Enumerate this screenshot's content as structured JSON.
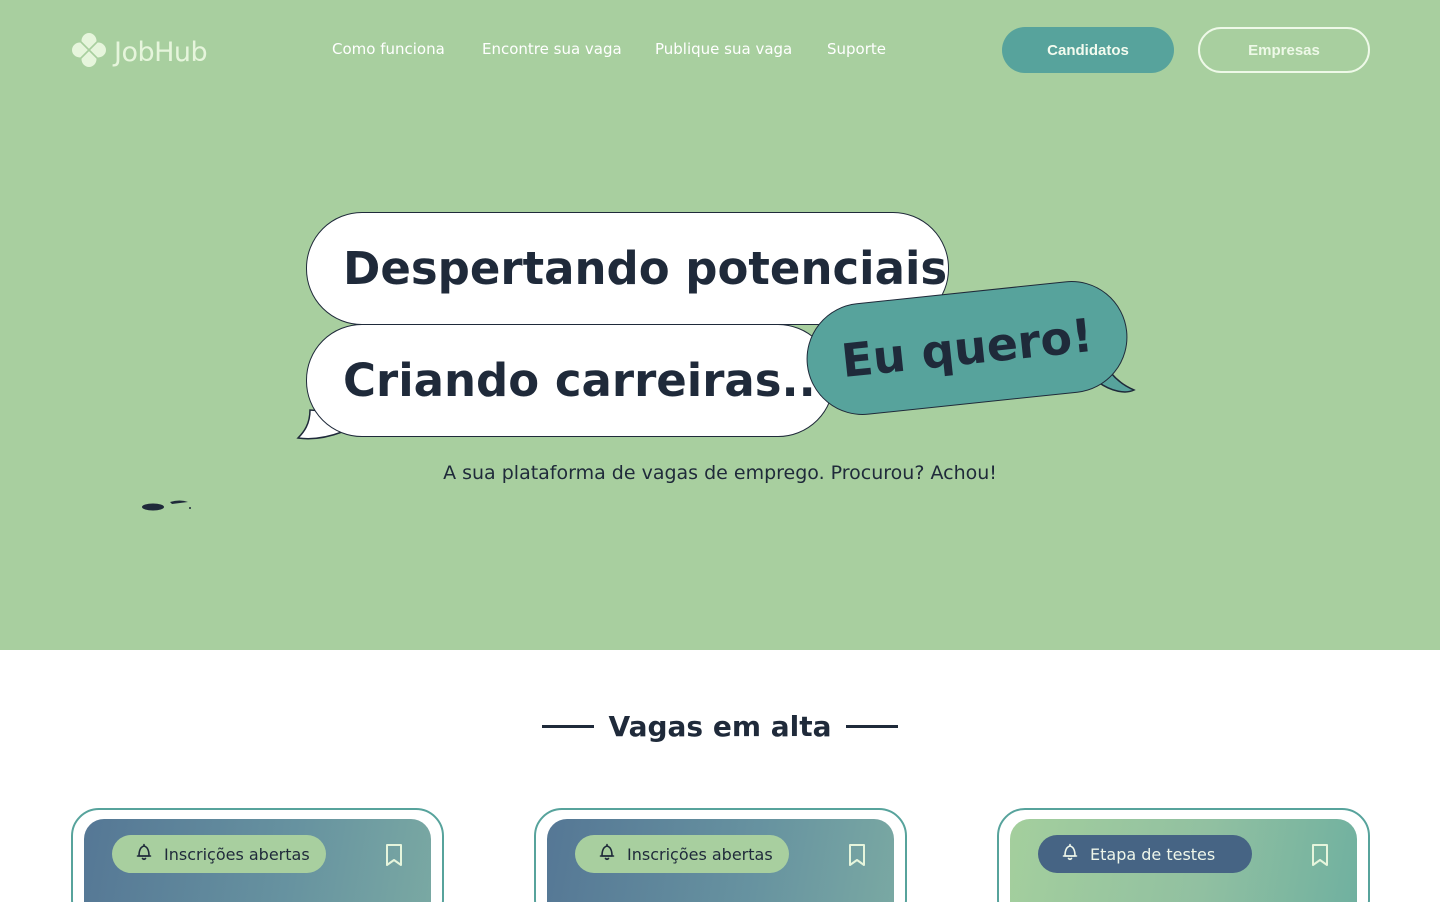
{
  "brand": {
    "name": "JobHub",
    "logo_icon": "clover-logo-icon"
  },
  "nav": {
    "items": [
      {
        "label": "Como funciona"
      },
      {
        "label": "Encontre sua vaga"
      },
      {
        "label": "Publique sua vaga"
      },
      {
        "label": "Suporte"
      }
    ],
    "candidates_button": "Candidatos",
    "companies_button": "Empresas"
  },
  "hero": {
    "headline_1": "Despertando potenciais",
    "headline_2": "Criando carreiras...",
    "cta_bubble": "Eu quero!",
    "subtitle": "A sua plataforma de vagas de emprego. Procurou? Achou!"
  },
  "trending": {
    "title": "Vagas em alta",
    "cards": [
      {
        "status": "Inscrições abertas",
        "status_icon": "bell-icon",
        "bookmark_icon": "bookmark-icon"
      },
      {
        "status": "Inscrições abertas",
        "status_icon": "bell-icon",
        "bookmark_icon": "bookmark-icon"
      },
      {
        "status": "Etapa de testes",
        "status_icon": "bell-icon",
        "bookmark_icon": "bookmark-icon"
      }
    ]
  },
  "colors": {
    "hero_bg": "#a8cf9f",
    "teal": "#57a39c",
    "navy": "#1f2a3a",
    "badge_dark": "#466484"
  }
}
